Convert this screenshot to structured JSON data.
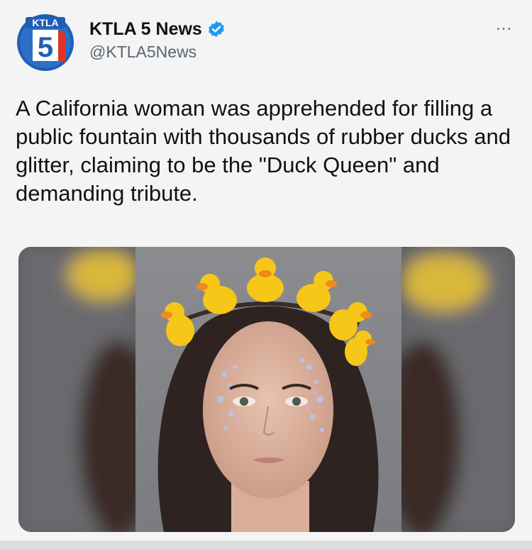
{
  "post": {
    "display_name": "KTLA 5 News",
    "handle": "@KTLA5News",
    "more_label": "...",
    "text": "A California woman was apprehended for filling a public fountain with thousands of rubber ducks and glitter, claiming to be the \"Duck Queen\" and demanding tribute."
  },
  "logo": {
    "wordmark": "KTLA",
    "number": "5"
  },
  "icons": {
    "verified": "verified-badge-icon",
    "more": "more-options-icon"
  },
  "colors": {
    "verified_blue": "#1d9bf0",
    "logo_blue": "#1f5fb3",
    "duck_yellow": "#f6c618"
  }
}
